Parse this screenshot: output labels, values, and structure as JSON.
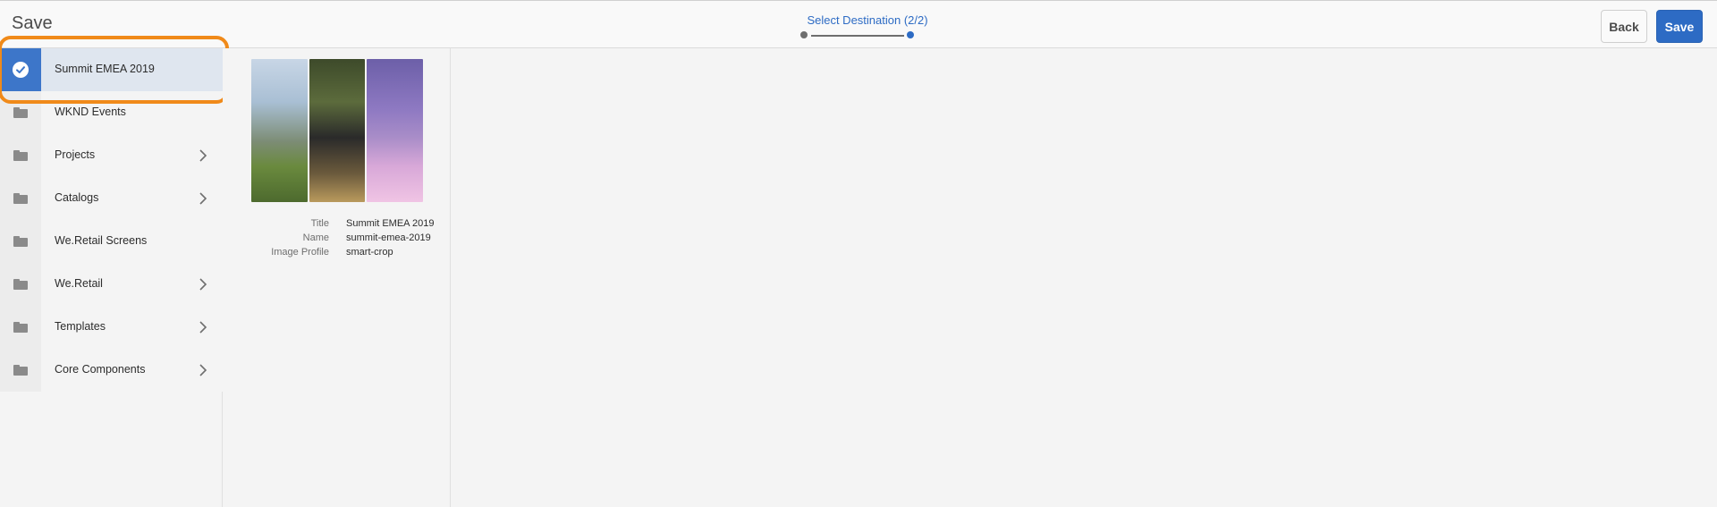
{
  "header": {
    "title": "Save",
    "wizard_step_label": "Select Destination (2/2)",
    "back_label": "Back",
    "save_label": "Save",
    "accent_color": "#2d6bc4"
  },
  "sidebar": {
    "items": [
      {
        "label": "Summit EMEA 2019",
        "selected": true,
        "icon": "check-circle-icon",
        "has_children": false
      },
      {
        "label": "WKND Events",
        "selected": false,
        "icon": "folder-icon",
        "has_children": false
      },
      {
        "label": "Projects",
        "selected": false,
        "icon": "folder-icon",
        "has_children": true
      },
      {
        "label": "Catalogs",
        "selected": false,
        "icon": "folder-icon",
        "has_children": true
      },
      {
        "label": "We.Retail Screens",
        "selected": false,
        "icon": "folder-icon",
        "has_children": false
      },
      {
        "label": "We.Retail",
        "selected": false,
        "icon": "folder-icon",
        "has_children": true
      },
      {
        "label": "Templates",
        "selected": false,
        "icon": "folder-icon",
        "has_children": true
      },
      {
        "label": "Core Components",
        "selected": false,
        "icon": "folder-icon",
        "has_children": true
      }
    ],
    "highlight_color": "#f08a1a"
  },
  "preview": {
    "rows": [
      {
        "key": "Title",
        "value": "Summit EMEA 2019"
      },
      {
        "key": "Name",
        "value": "summit-emea-2019"
      },
      {
        "key": "Image Profile",
        "value": "smart-crop"
      }
    ]
  }
}
